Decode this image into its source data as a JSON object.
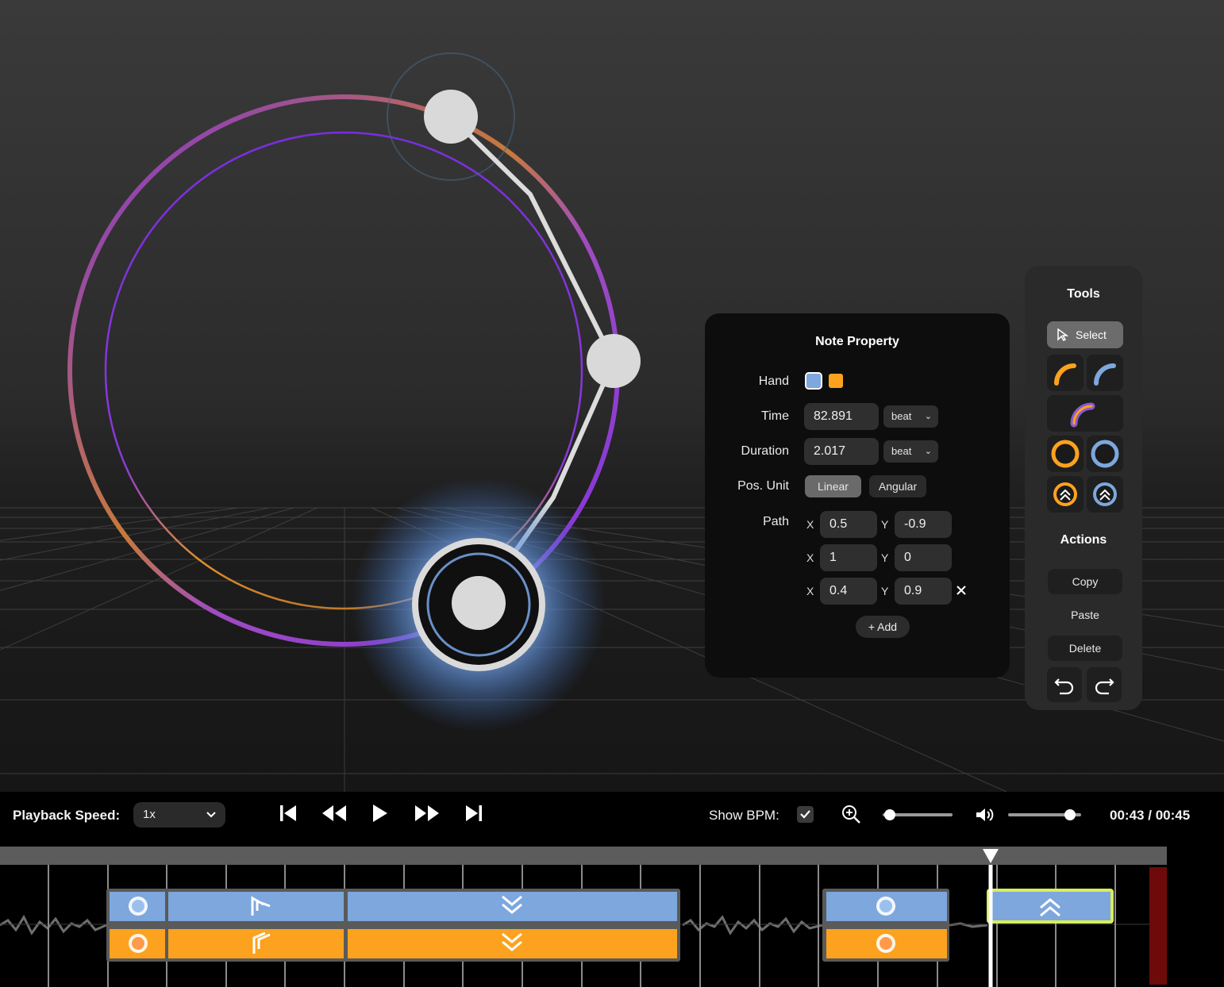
{
  "colors": {
    "left_hand": "#7da7dd",
    "right_hand": "#fca21e",
    "ring": "#7a2ee0",
    "selected_outline": "#d8ee5c",
    "panel_bg": "#0d0d0d",
    "end_marker": "#6e0a0a"
  },
  "note_property": {
    "title": "Note Property",
    "hand": {
      "label": "Hand",
      "options": [
        "left",
        "right"
      ],
      "selected": "left"
    },
    "time": {
      "label": "Time",
      "value": "82.891",
      "unit": "beat"
    },
    "duration": {
      "label": "Duration",
      "value": "2.017",
      "unit": "beat"
    },
    "pos_unit": {
      "label": "Pos. Unit",
      "options": [
        "Linear",
        "Angular"
      ],
      "selected": "Linear"
    },
    "path": {
      "label": "Path",
      "x_label": "X",
      "y_label": "Y",
      "points": [
        {
          "x": "0.5",
          "y": "-0.9"
        },
        {
          "x": "1",
          "y": "0"
        },
        {
          "x": "0.4",
          "y": "0.9"
        }
      ],
      "remove_icon": "close-icon",
      "add_label": "+ Add"
    }
  },
  "tools": {
    "title": "Tools",
    "select_label": "Select",
    "items": [
      "arc-right-tool",
      "arc-left-tool",
      "arc-both-tool",
      "circle-right-tool",
      "circle-left-tool",
      "flick-right-tool",
      "flick-left-tool"
    ]
  },
  "actions": {
    "title": "Actions",
    "copy": "Copy",
    "paste": "Paste",
    "delete": "Delete",
    "undo_icon": "undo-icon",
    "redo_icon": "redo-icon"
  },
  "controls": {
    "playback_speed_label": "Playback Speed:",
    "playback_speed_value": "1x",
    "show_bpm_label": "Show BPM:",
    "show_bpm_checked": true,
    "zoom_level": 0.1,
    "volume_level": 0.85,
    "current_time": "00:43",
    "time_separator": "/",
    "total_time": "00:45"
  }
}
